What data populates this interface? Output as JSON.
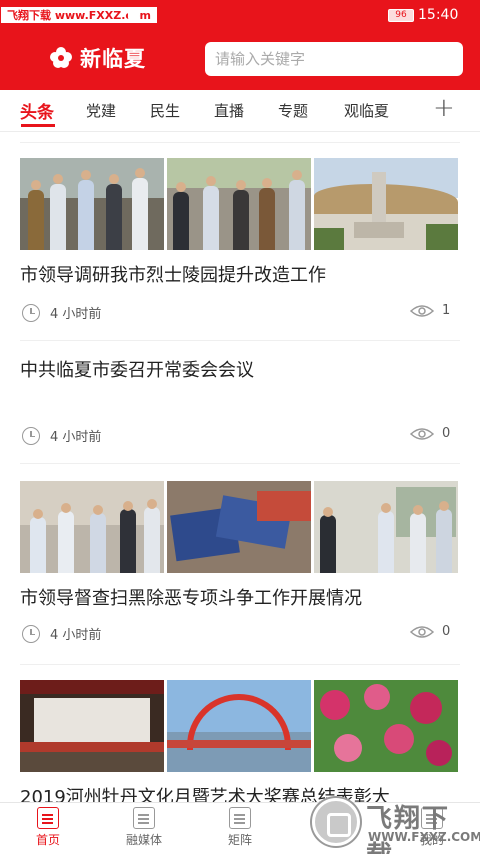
{
  "status_bar": {
    "watermark": "飞翔下载 www.FXXZ.com",
    "battery": "96",
    "time": "15:40"
  },
  "header": {
    "app_name": "新临夏",
    "search_placeholder": "请输入关键字"
  },
  "tabs": [
    {
      "label": "头条",
      "active": true
    },
    {
      "label": "党建",
      "active": false
    },
    {
      "label": "民生",
      "active": false
    },
    {
      "label": "直播",
      "active": false
    },
    {
      "label": "专题",
      "active": false
    },
    {
      "label": "观临夏",
      "active": false
    }
  ],
  "news": [
    {
      "title": "市领导调研我市烈士陵园提升改造工作",
      "time": "4 小时前",
      "views": "1",
      "images": [
        "officials-group-photo",
        "officials-walking-photo",
        "martyrs-monument-photo"
      ]
    },
    {
      "title": "中共临夏市委召开常委会会议",
      "time": "4 小时前",
      "views": "0",
      "images": []
    },
    {
      "title": "市领导督查扫黑除恶专项斗争工作开展情况",
      "time": "4 小时前",
      "views": "0",
      "images": [
        "officials-inspection-photo",
        "brochures-photo",
        "shop-visit-photo"
      ]
    },
    {
      "title": "2019河州牡丹文化月暨艺术大奖赛总结表彰大",
      "images": [
        "auditorium-photo",
        "stage-arch-photo",
        "peony-garden-photo"
      ]
    }
  ],
  "bottom_nav": [
    {
      "label": "首页",
      "active": true
    },
    {
      "label": "融媒体",
      "active": false
    },
    {
      "label": "矩阵",
      "active": false
    },
    {
      "label": "服务",
      "active": false
    },
    {
      "label": "我的",
      "active": false
    }
  ],
  "watermark_bottom": {
    "text": "飞翔下载",
    "url": "WWW.FXXZ.COM"
  },
  "colors": {
    "brand_red": "#e8141b"
  }
}
